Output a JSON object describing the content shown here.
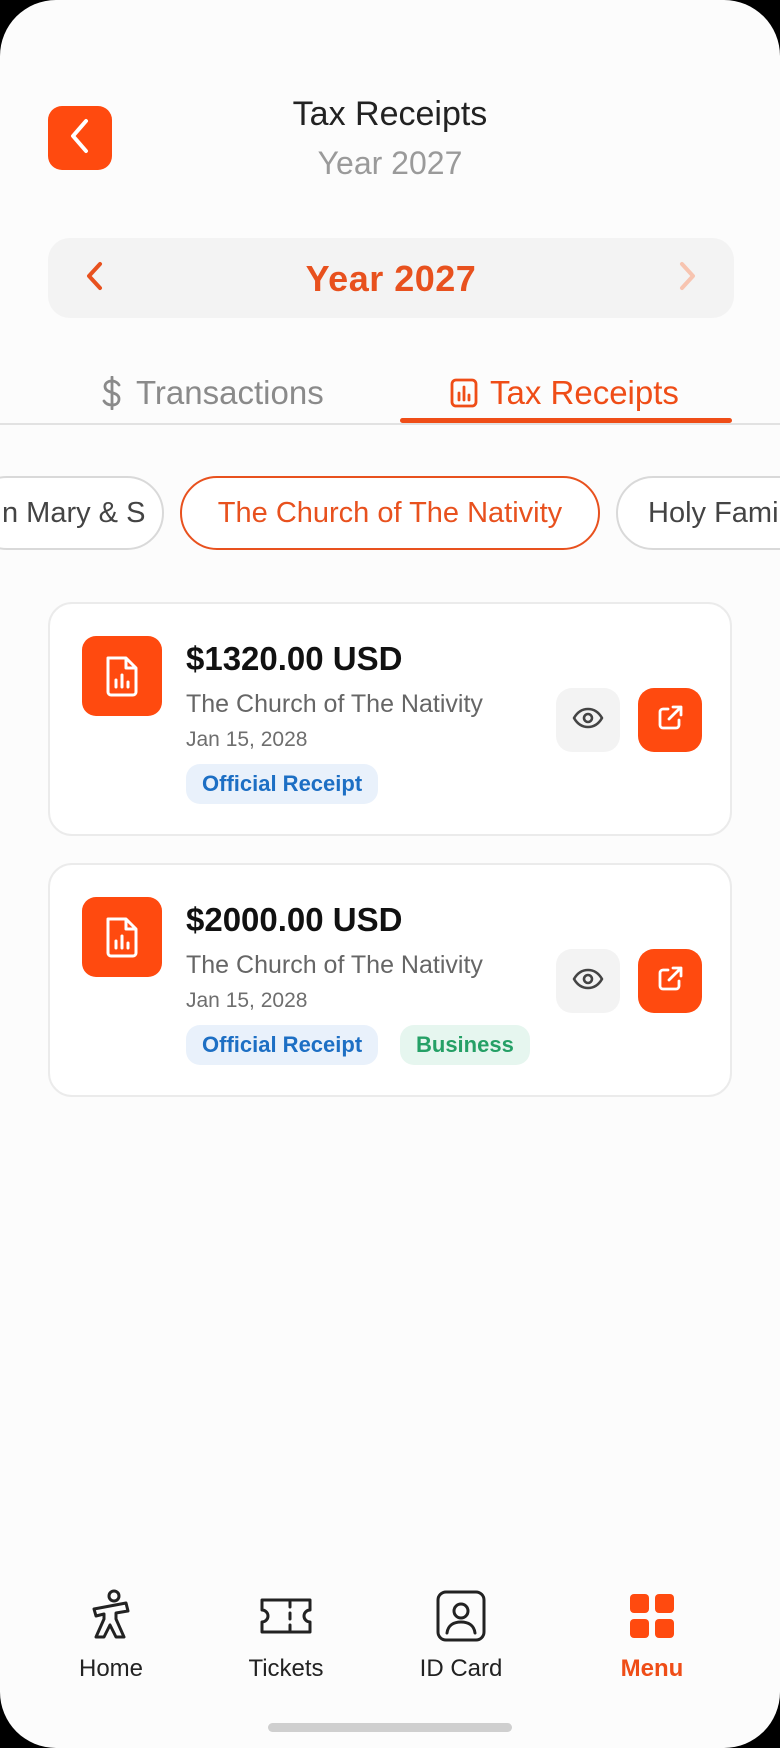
{
  "header": {
    "title": "Tax Receipts",
    "subtitle": "Year 2027"
  },
  "year_selector": {
    "label": "Year 2027"
  },
  "tabs": [
    {
      "label": "Transactions",
      "icon": "dollar-icon",
      "active": false
    },
    {
      "label": "Tax Receipts",
      "icon": "report-icon",
      "active": true
    }
  ],
  "chips": [
    {
      "label": "n Mary & S",
      "selected": false
    },
    {
      "label": "The Church of The Nativity",
      "selected": true
    },
    {
      "label": "Holy Fami",
      "selected": false
    }
  ],
  "receipts": [
    {
      "amount": "$1320.00 USD",
      "organization": "The Church of The Nativity",
      "date": "Jan 15, 2028",
      "badges": [
        "Official Receipt"
      ]
    },
    {
      "amount": "$2000.00 USD",
      "organization": "The Church of The Nativity",
      "date": "Jan 15, 2028",
      "badges": [
        "Official Receipt",
        "Business"
      ]
    }
  ],
  "bottom_nav": [
    {
      "label": "Home",
      "icon": "home-icon",
      "active": false
    },
    {
      "label": "Tickets",
      "icon": "ticket-icon",
      "active": false
    },
    {
      "label": "ID Card",
      "icon": "id-card-icon",
      "active": false
    },
    {
      "label": "Menu",
      "icon": "grid-menu-icon",
      "active": true
    }
  ],
  "colors": {
    "accent": "#ff4a0f",
    "accent_text": "#e8511e",
    "badge_official": "#1d6fc4",
    "badge_business": "#25a066"
  }
}
